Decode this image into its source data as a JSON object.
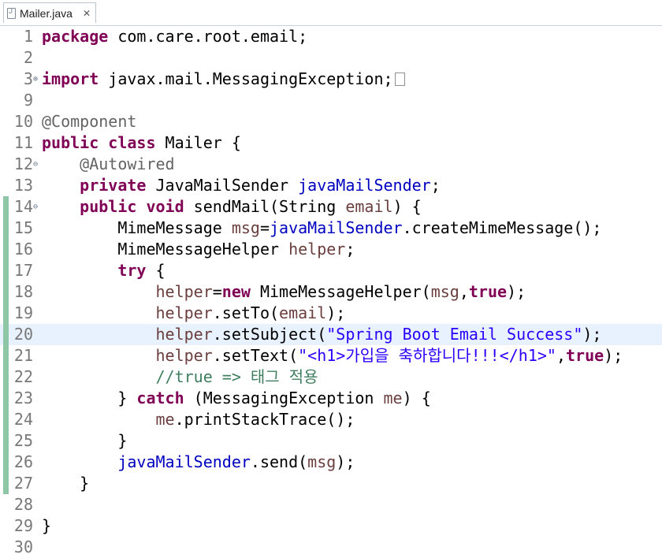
{
  "tab": {
    "title": "Mailer.java",
    "close_glyph": "✕"
  },
  "editor": {
    "current_line": "20",
    "fold_glyphs": {
      "expanded": "⊖",
      "collapsed": "⊕"
    },
    "lines": [
      {
        "n": "1",
        "tokens": [
          {
            "t": "package",
            "c": "kw"
          },
          {
            "t": " com.care.root.email;",
            "c": ""
          }
        ]
      },
      {
        "n": "2",
        "tokens": []
      },
      {
        "n": "3",
        "fold": "collapsed",
        "tokens": [
          {
            "t": "import",
            "c": "kw"
          },
          {
            "t": " javax.mail.MessagingException;",
            "c": ""
          }
        ],
        "collapsed_box": true
      },
      {
        "n": "9",
        "tokens": []
      },
      {
        "n": "10",
        "tokens": [
          {
            "t": "@Component",
            "c": "ann"
          }
        ]
      },
      {
        "n": "11",
        "tokens": [
          {
            "t": "public",
            "c": "kw"
          },
          {
            "t": " ",
            "c": ""
          },
          {
            "t": "class",
            "c": "kw"
          },
          {
            "t": " Mailer {",
            "c": ""
          }
        ]
      },
      {
        "n": "12",
        "fold": "expanded",
        "tokens": [
          {
            "t": "    ",
            "c": ""
          },
          {
            "t": "@Autowired",
            "c": "ann"
          }
        ]
      },
      {
        "n": "13",
        "tokens": [
          {
            "t": "    ",
            "c": ""
          },
          {
            "t": "private",
            "c": "kw"
          },
          {
            "t": " JavaMailSender ",
            "c": ""
          },
          {
            "t": "javaMailSender",
            "c": "fld"
          },
          {
            "t": ";",
            "c": ""
          }
        ]
      },
      {
        "n": "14",
        "fold": "expanded",
        "mark": true,
        "tokens": [
          {
            "t": "    ",
            "c": ""
          },
          {
            "t": "public",
            "c": "kw"
          },
          {
            "t": " ",
            "c": ""
          },
          {
            "t": "void",
            "c": "kw"
          },
          {
            "t": " sendMail(String ",
            "c": ""
          },
          {
            "t": "email",
            "c": "var"
          },
          {
            "t": ") {",
            "c": ""
          }
        ]
      },
      {
        "n": "15",
        "mark": true,
        "tokens": [
          {
            "t": "        MimeMessage ",
            "c": ""
          },
          {
            "t": "msg",
            "c": "var"
          },
          {
            "t": "=",
            "c": ""
          },
          {
            "t": "javaMailSender",
            "c": "fld"
          },
          {
            "t": ".createMimeMessage();",
            "c": ""
          }
        ]
      },
      {
        "n": "16",
        "mark": true,
        "tokens": [
          {
            "t": "        MimeMessageHelper ",
            "c": ""
          },
          {
            "t": "helper",
            "c": "var"
          },
          {
            "t": ";",
            "c": ""
          }
        ]
      },
      {
        "n": "17",
        "mark": true,
        "tokens": [
          {
            "t": "        ",
            "c": ""
          },
          {
            "t": "try",
            "c": "kw"
          },
          {
            "t": " {",
            "c": ""
          }
        ]
      },
      {
        "n": "18",
        "mark": true,
        "tokens": [
          {
            "t": "            ",
            "c": ""
          },
          {
            "t": "helper",
            "c": "var"
          },
          {
            "t": "=",
            "c": ""
          },
          {
            "t": "new",
            "c": "kw"
          },
          {
            "t": " MimeMessageHelper(",
            "c": ""
          },
          {
            "t": "msg",
            "c": "var"
          },
          {
            "t": ",",
            "c": ""
          },
          {
            "t": "true",
            "c": "kw"
          },
          {
            "t": ");",
            "c": ""
          }
        ]
      },
      {
        "n": "19",
        "mark": true,
        "tokens": [
          {
            "t": "            ",
            "c": ""
          },
          {
            "t": "helper",
            "c": "var"
          },
          {
            "t": ".setTo(",
            "c": ""
          },
          {
            "t": "email",
            "c": "var"
          },
          {
            "t": ");",
            "c": ""
          }
        ]
      },
      {
        "n": "20",
        "mark": true,
        "tokens": [
          {
            "t": "            ",
            "c": ""
          },
          {
            "t": "helper",
            "c": "var"
          },
          {
            "t": ".setSubject(",
            "c": ""
          },
          {
            "t": "\"Spring Boot Email Success\"",
            "c": "str"
          },
          {
            "t": ");",
            "c": ""
          }
        ]
      },
      {
        "n": "21",
        "mark": true,
        "tokens": [
          {
            "t": "            ",
            "c": ""
          },
          {
            "t": "helper",
            "c": "var"
          },
          {
            "t": ".setText(",
            "c": ""
          },
          {
            "t": "\"<h1>가입을 축하합니다!!!</h1>\"",
            "c": "str"
          },
          {
            "t": ",",
            "c": ""
          },
          {
            "t": "true",
            "c": "kw"
          },
          {
            "t": ");",
            "c": ""
          }
        ]
      },
      {
        "n": "22",
        "mark": true,
        "tokens": [
          {
            "t": "            ",
            "c": ""
          },
          {
            "t": "//true => 태그 적용",
            "c": "cmt"
          }
        ]
      },
      {
        "n": "23",
        "mark": true,
        "tokens": [
          {
            "t": "        } ",
            "c": ""
          },
          {
            "t": "catch",
            "c": "kw"
          },
          {
            "t": " (MessagingException ",
            "c": ""
          },
          {
            "t": "me",
            "c": "var"
          },
          {
            "t": ") {",
            "c": ""
          }
        ]
      },
      {
        "n": "24",
        "mark": true,
        "tokens": [
          {
            "t": "            ",
            "c": ""
          },
          {
            "t": "me",
            "c": "var"
          },
          {
            "t": ".printStackTrace();",
            "c": ""
          }
        ]
      },
      {
        "n": "25",
        "mark": true,
        "tokens": [
          {
            "t": "        }",
            "c": ""
          }
        ]
      },
      {
        "n": "26",
        "mark": true,
        "tokens": [
          {
            "t": "        ",
            "c": ""
          },
          {
            "t": "javaMailSender",
            "c": "fld"
          },
          {
            "t": ".send(",
            "c": ""
          },
          {
            "t": "msg",
            "c": "var"
          },
          {
            "t": ");",
            "c": ""
          }
        ]
      },
      {
        "n": "27",
        "mark": true,
        "tokens": [
          {
            "t": "    }",
            "c": ""
          }
        ]
      },
      {
        "n": "28",
        "tokens": []
      },
      {
        "n": "29",
        "tokens": [
          {
            "t": "}",
            "c": ""
          }
        ]
      },
      {
        "n": "30",
        "tokens": []
      }
    ]
  },
  "colors": {
    "keyword": "#7f0055",
    "annotation": "#646464",
    "field": "#0000c0",
    "local_variable": "#6a3e3e",
    "string": "#2a00ff",
    "comment": "#3f7f5f",
    "current_line": "#e8f2fe",
    "change_marker": "#8fc7a6"
  }
}
